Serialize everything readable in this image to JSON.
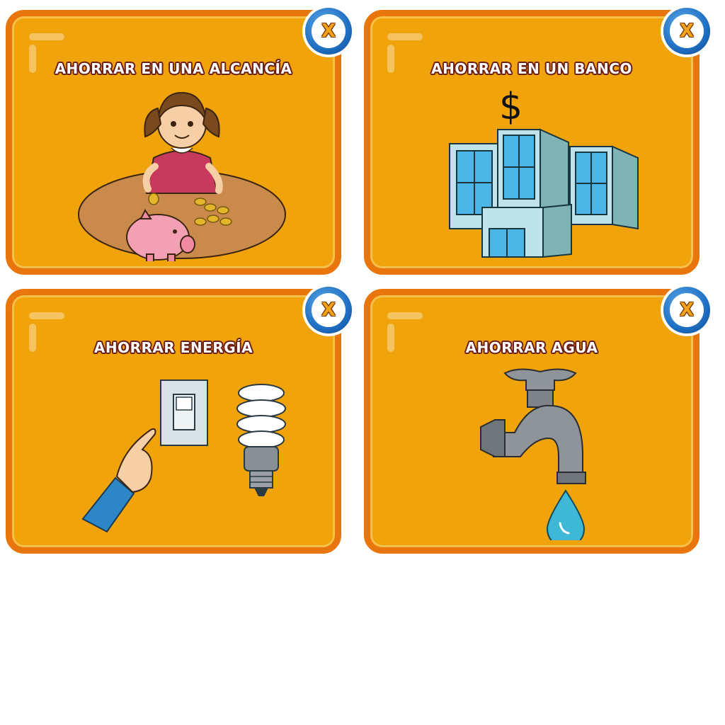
{
  "cards": [
    {
      "title": "AHORRAR EN UNA ALCANCÍA",
      "close_label": "X",
      "illustration": "girl-piggy-bank"
    },
    {
      "title": "AHORRAR EN UN BANCO",
      "close_label": "X",
      "illustration": "bank-building",
      "sign": "$"
    },
    {
      "title": "AHORRAR ENERGÍA",
      "close_label": "X",
      "illustration": "light-switch-and-bulb"
    },
    {
      "title": "AHORRAR AGUA",
      "close_label": "X",
      "illustration": "water-tap-drop"
    }
  ],
  "colors": {
    "card_fill": "#f0a30a",
    "card_border": "#e8760d",
    "close_blue": "#1f6fc3",
    "title_outline": "#6b1e14"
  }
}
